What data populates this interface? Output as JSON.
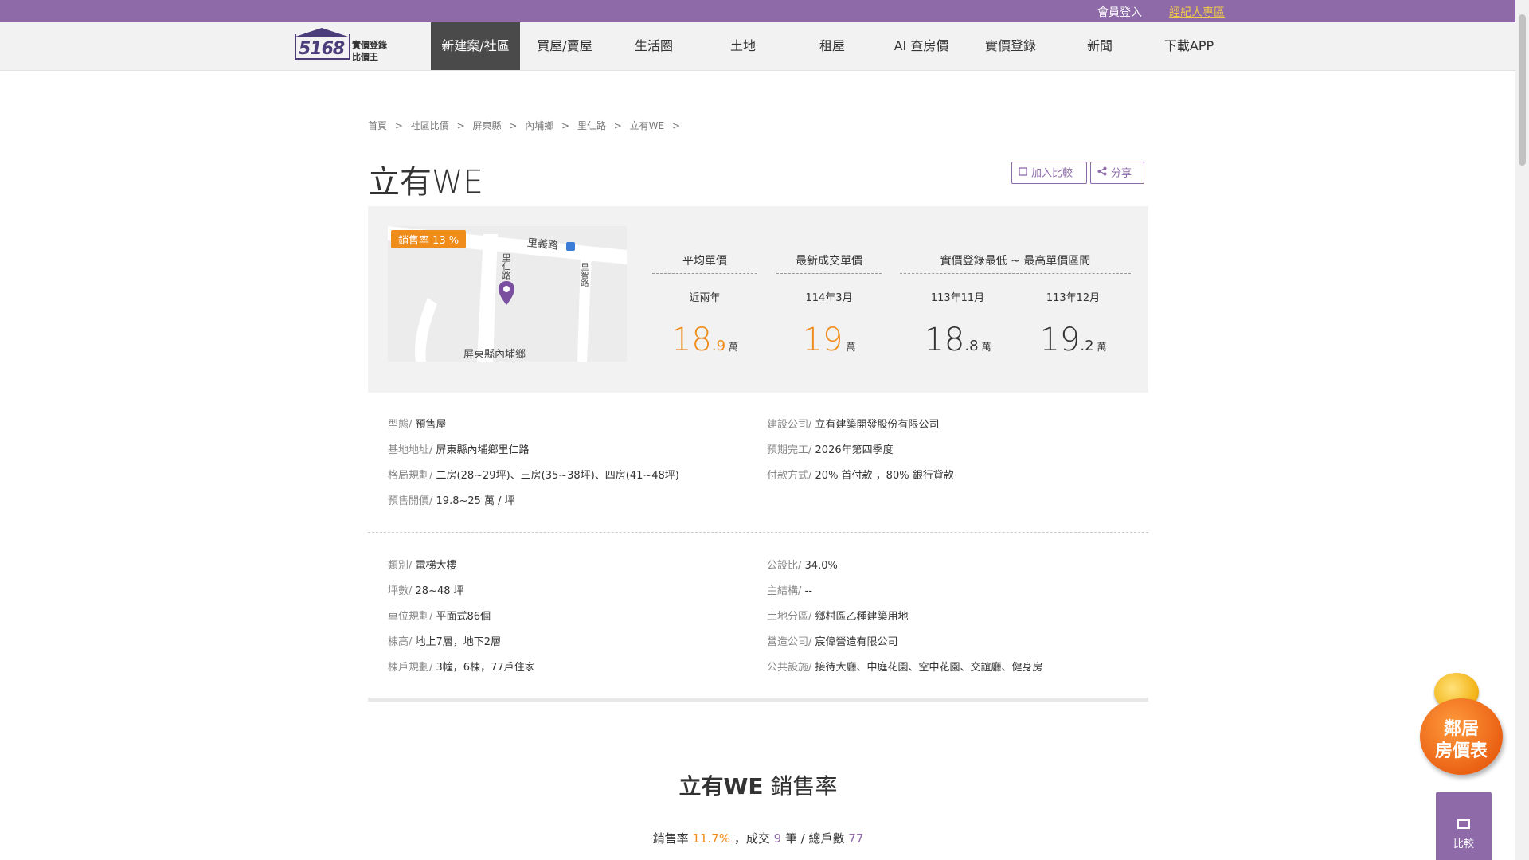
{
  "topbar": {
    "login": "會員登入",
    "agent": "經紀人專區"
  },
  "logo": {
    "number": "5168",
    "line1": "實價登錄",
    "line2": "比價王"
  },
  "nav": [
    "新建案/社區",
    "買屋/賣屋",
    "生活圈",
    "土地",
    "租屋",
    "AI 查房價",
    "實價登錄",
    "新聞",
    "下載APP"
  ],
  "breadcrumb": [
    "首頁",
    ">",
    "社區比價",
    ">",
    "屏東縣",
    ">",
    "內埔鄉",
    ">",
    "里仁路",
    ">",
    "立有WE",
    ">"
  ],
  "title": "立有WE",
  "buttons": {
    "compare": "加入比較",
    "share": "分享"
  },
  "map": {
    "sales_badge": "銷售率 13 %",
    "road1": "里義路",
    "road2": "里仁路",
    "road3": "里智路",
    "area": "屏東縣內埔鄉"
  },
  "stats": {
    "avg_label": "平均單價",
    "avg_sub": "近兩年",
    "avg_int": "18",
    "avg_dec": ".9",
    "latest_label": "最新成交單價",
    "latest_sub": "114年3月",
    "latest_int": "19",
    "latest_dec": "",
    "range_label": "實價登錄最低 ~ 最高單價區間",
    "low_sub": "113年11月",
    "low_int": "18",
    "low_dec": ".8",
    "high_sub": "113年12月",
    "high_int": "19",
    "high_dec": ".2",
    "unit": "萬"
  },
  "details1": {
    "left": [
      {
        "k": "型態/",
        "v": " 預售屋"
      },
      {
        "k": "基地地址/",
        "v": " 屏東縣內埔鄉里仁路"
      },
      {
        "k": "格局規劃/",
        "v": " 二房(28~29坪)、三房(35~38坪)、四房(41~48坪)"
      },
      {
        "k": "預售開價/",
        "v": " 19.8~25 萬 / 坪"
      }
    ],
    "right": [
      {
        "k": "建設公司/",
        "v": " 立有建築開發股份有限公司"
      },
      {
        "k": "預期完工/",
        "v": " 2026年第四季度"
      },
      {
        "k": "付款方式/",
        "v": " 20% 首付款 ，80% 銀行貸款"
      }
    ]
  },
  "details2": {
    "left": [
      {
        "k": "類別/",
        "v": " 電梯大樓"
      },
      {
        "k": "坪數/",
        "v": " 28~48 坪"
      },
      {
        "k": "車位規劃/",
        "v": " 平面式86個"
      },
      {
        "k": "棟高/",
        "v": " 地上7層，地下2層"
      },
      {
        "k": "棟戶規劃/",
        "v": " 3幢，6棟，77戶住家"
      }
    ],
    "right": [
      {
        "k": "公設比/",
        "v": " 34.0%"
      },
      {
        "k": "主結構/",
        "v": " --"
      },
      {
        "k": "土地分區/",
        "v": " 鄉村區乙種建築用地"
      },
      {
        "k": "營造公司/",
        "v": " 宸偉營造有限公司"
      },
      {
        "k": "公共設施/",
        "v": " 接待大廳、中庭花園、空中花園、交誼廳、健身房"
      }
    ]
  },
  "sales_section": {
    "title_bold": "立有WE",
    "title_rest": " 銷售率",
    "rate_label": "銷售率 ",
    "rate_value": "11.7%",
    "deals_label": " ，成交 ",
    "deals_value": "9",
    "deals_unit": " 筆 / 總戶數 ",
    "total_value": "77"
  },
  "float_badge": {
    "line1": "鄰居",
    "line2": "房價表"
  },
  "compare_tab": {
    "label": "比較"
  },
  "colors": {
    "purple": "#8e6aa8",
    "orange": "#f08c1a",
    "nav_active": "#4a4a4a"
  }
}
